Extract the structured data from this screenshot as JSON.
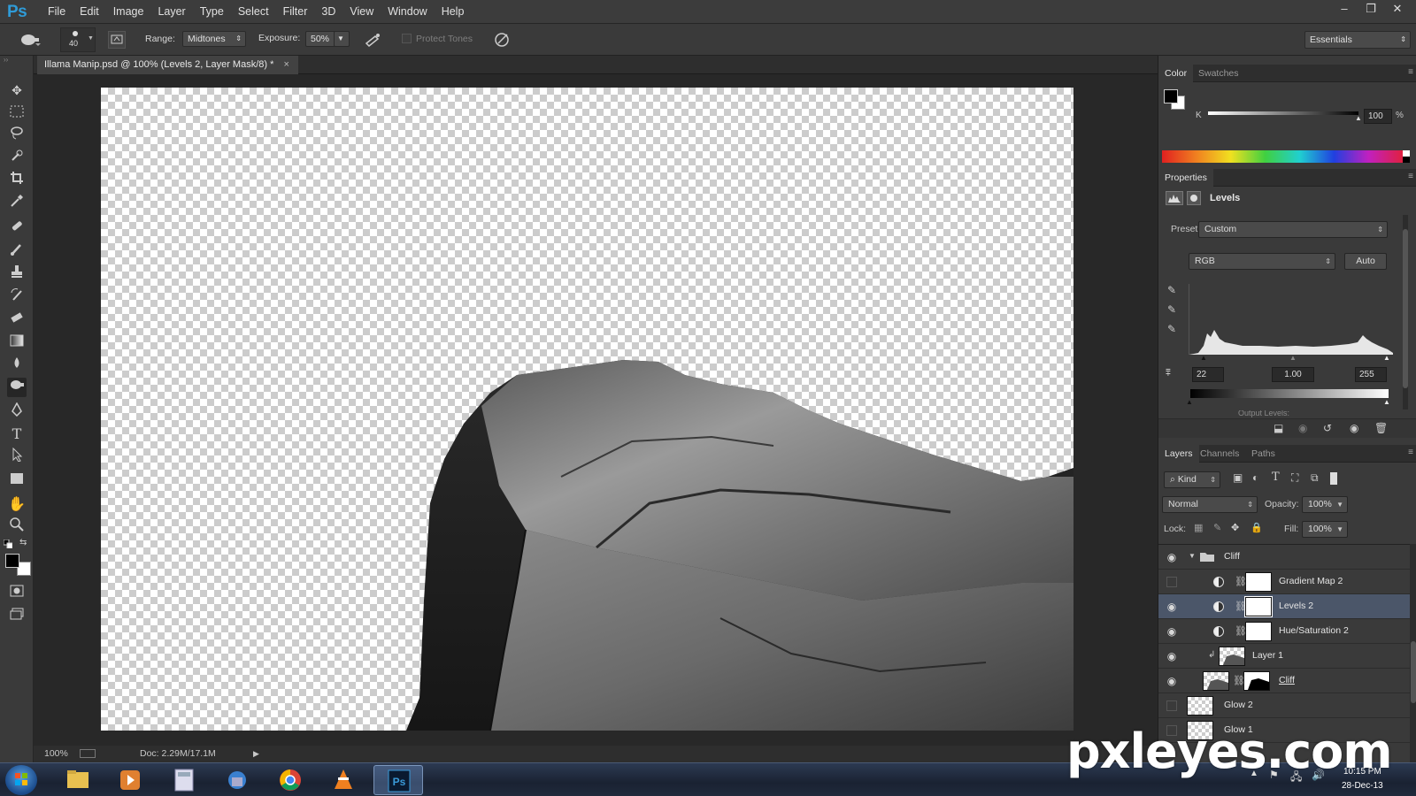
{
  "app": {
    "logo": "Ps"
  },
  "menu": [
    "File",
    "Edit",
    "Image",
    "Layer",
    "Type",
    "Select",
    "Filter",
    "3D",
    "View",
    "Window",
    "Help"
  ],
  "window_controls": {
    "minimize": "–",
    "restore": "❐",
    "close": "✕"
  },
  "options": {
    "brush_size": "40",
    "range_label": "Range:",
    "range_value": "Midtones",
    "exposure_label": "Exposure:",
    "exposure_value": "50%",
    "protect_tones": "Protect Tones",
    "workspace": "Essentials"
  },
  "document": {
    "tab_title": "Illama Manip.psd @ 100% (Levels 2, Layer Mask/8) *",
    "tab_close": "×"
  },
  "status": {
    "zoom": "100%",
    "doc_size": "Doc: 2.29M/17.1M"
  },
  "color_panel": {
    "tabs": [
      "Color",
      "Swatches"
    ],
    "channel_label": "K",
    "value": "100",
    "unit": "%"
  },
  "properties": {
    "tab": "Properties",
    "title": "Levels",
    "preset_label": "Preset:",
    "preset_value": "Custom",
    "channel": "RGB",
    "auto_button": "Auto",
    "input_black": "22",
    "input_gamma": "1.00",
    "input_white": "255",
    "output_label": "Output Levels:"
  },
  "layers_panel": {
    "tabs": [
      "Layers",
      "Channels",
      "Paths"
    ],
    "filter_kind": "Kind",
    "blend_mode": "Normal",
    "opacity_label": "Opacity:",
    "opacity_value": "100%",
    "lock_label": "Lock:",
    "fill_label": "Fill:",
    "fill_value": "100%",
    "layers": [
      {
        "name": "Cliff"
      },
      {
        "name": "Gradient Map 2"
      },
      {
        "name": "Levels 2"
      },
      {
        "name": "Hue/Saturation 2"
      },
      {
        "name": "Layer 1"
      },
      {
        "name": "Cliff"
      },
      {
        "name": "Glow 2"
      },
      {
        "name": "Glow 1"
      }
    ]
  },
  "taskbar": {
    "time": "10:15 PM",
    "date": "28-Dec-13"
  },
  "watermark": "pxleyes.com",
  "colors": {
    "accent": "#2f9bd7",
    "selected_layer": "#4b5669",
    "panel_bg": "#3a3a3a"
  }
}
